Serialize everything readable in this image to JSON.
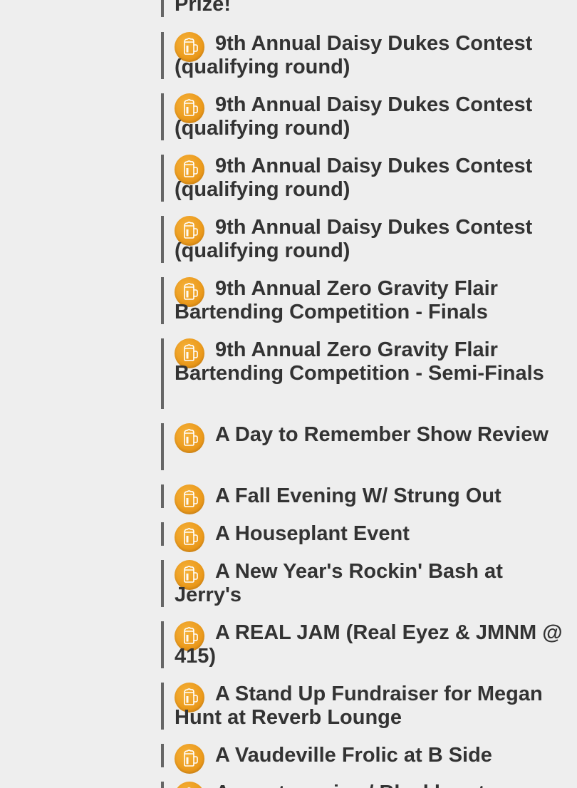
{
  "colors": {
    "background": "#eeeeee",
    "text": "#333333",
    "item_border": "#666666",
    "icon_orange": "#eb9a1c"
  },
  "icon": "beer-mug-icon",
  "partial_top_title": "Prize!",
  "events": [
    {
      "title": "9th Annual Daisy Dukes Contest (qualifying round)"
    },
    {
      "title": "9th Annual Daisy Dukes Contest (qualifying round)"
    },
    {
      "title": "9th Annual Daisy Dukes Contest (qualifying round)"
    },
    {
      "title": "9th Annual Daisy Dukes Contest (qualifying round)"
    },
    {
      "title": "9th Annual Zero Gravity Flair Bartending Competition - Finals"
    },
    {
      "title": "9th Annual Zero Gravity Flair Bartending Competition - Semi-Finals"
    },
    {
      "title": "A Day to Remember Show Review"
    },
    {
      "title": "A Fall Evening W/ Strung Out"
    },
    {
      "title": "A Houseplant Event"
    },
    {
      "title": "A New Year's Rockin' Bash at Jerry's"
    },
    {
      "title": "A REAL JAM (Real Eyez & JMNM @ 415)"
    },
    {
      "title": "A Stand Up Fundraiser for Megan Hunt at Reverb Lounge"
    },
    {
      "title": "A Vaudeville Frolic at B Side"
    },
    {
      "title": "Acoustasonics / Blackhearts"
    }
  ]
}
